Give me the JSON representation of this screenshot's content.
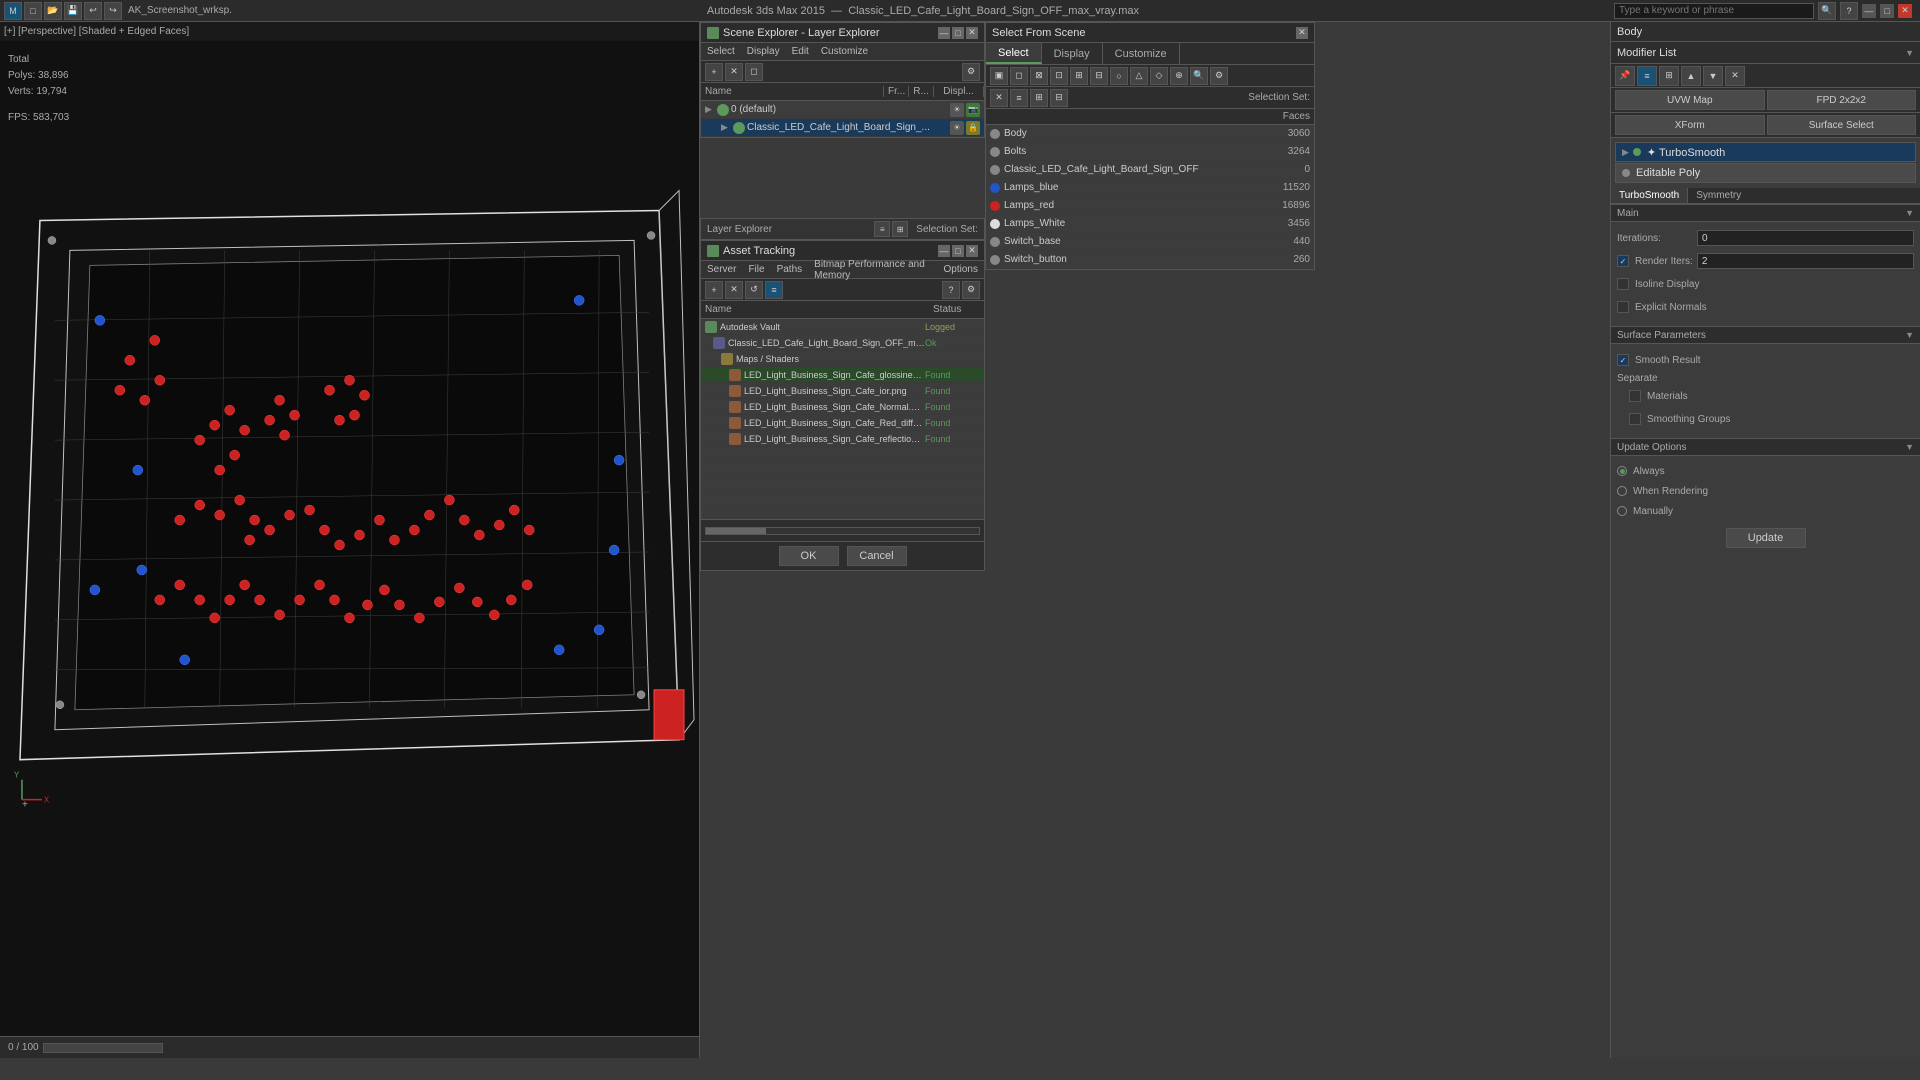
{
  "app": {
    "title": "Autodesk 3ds Max 2015",
    "file": "Classic_LED_Cafe_Light_Board_Sign_OFF_max_vray.max",
    "titlebar_label": "AK_Screenshot_wrksp."
  },
  "search": {
    "placeholder": "Type a keyword or phrase"
  },
  "viewport": {
    "label": "[+] [Perspective] [Shaded + Edged Faces]",
    "stats_label": "Total",
    "polys_label": "Polys:",
    "polys_value": "38,896",
    "verts_label": "Verts:",
    "verts_value": "19,794",
    "fps_label": "FPS:",
    "fps_value": "583,703",
    "progress": "0 / 100"
  },
  "layer_explorer": {
    "title": "Scene Explorer - Layer Explorer",
    "menu_items": [
      "Select",
      "Display",
      "Edit",
      "Customize"
    ],
    "columns": [
      "Name",
      "Fr...",
      "R...",
      "Displ..."
    ],
    "layers": [
      {
        "name": "0 (default)",
        "level": 0,
        "expanded": true
      },
      {
        "name": "Classic_LED_Cafe_Light_Board_Sign_...",
        "level": 1,
        "expanded": true
      }
    ]
  },
  "explorer_bottom": {
    "label": "Layer Explorer",
    "selection_set": "Selection Set:"
  },
  "select_from_scene": {
    "title": "Select From Scene",
    "tabs": [
      "Select",
      "Display",
      "Customize"
    ],
    "active_tab": "Select",
    "toolbar_btn_labels": [
      "all",
      "none",
      "invert",
      "sel_dep"
    ],
    "list_header_label": "Faces",
    "selection_set_label": "Selection Set:",
    "items": [
      {
        "name": "Body",
        "count": "3060"
      },
      {
        "name": "Bolts",
        "count": "3264"
      },
      {
        "name": "Classic_LED_Cafe_Light_Board_Sign_OFF",
        "count": "0"
      },
      {
        "name": "Lamps_blue",
        "count": "11520"
      },
      {
        "name": "Lamps_red",
        "count": "16896"
      },
      {
        "name": "Lamps_White",
        "count": "3456"
      },
      {
        "name": "Switch_base",
        "count": "440"
      },
      {
        "name": "Switch_button",
        "count": "260"
      }
    ]
  },
  "asset_tracking": {
    "title": "Asset Tracking",
    "menu_items": [
      "Server",
      "File",
      "Paths",
      "Bitmap Performance and Memory",
      "Options"
    ],
    "columns": [
      "Name",
      "Status"
    ],
    "items": [
      {
        "name": "Autodesk Vault",
        "level": 0,
        "type": "vault",
        "status": "Logged"
      },
      {
        "name": "Classic_LED_Cafe_Light_Board_Sign_OFF_max_vr...",
        "level": 1,
        "type": "file",
        "status": "Ok"
      },
      {
        "name": "Maps / Shaders",
        "level": 2,
        "type": "folder",
        "status": ""
      },
      {
        "name": "LED_Light_Business_Sign_Cafe_glossiness...",
        "level": 3,
        "type": "texture",
        "status": "Found"
      },
      {
        "name": "LED_Light_Business_Sign_Cafe_ior.png",
        "level": 3,
        "type": "texture",
        "status": "Found"
      },
      {
        "name": "LED_Light_Business_Sign_Cafe_Normal.png",
        "level": 3,
        "type": "texture",
        "status": "Found"
      },
      {
        "name": "LED_Light_Business_Sign_Cafe_Red_diffus...",
        "level": 3,
        "type": "texture",
        "status": "Found"
      },
      {
        "name": "LED_Light_Business_Sign_Cafe_reflection.p...",
        "level": 3,
        "type": "texture",
        "status": "Found"
      }
    ],
    "ok_btn": "OK",
    "cancel_btn": "Cancel"
  },
  "modifier_panel": {
    "title": "Body",
    "modifier_list_label": "Modifier List",
    "stack_items": [
      {
        "name": "TurboSmooth",
        "type": "modifier",
        "arrow": true
      },
      {
        "name": "Editable Poly",
        "type": "base"
      }
    ],
    "buttons": [
      "UVW Map",
      "FPD 2x2x2",
      "XForm",
      "Surface Select"
    ],
    "turbosmo_tabs": [
      "TurboSmooth",
      "Symmetry"
    ],
    "main_section": "Main",
    "iterations_label": "Iterations:",
    "iterations_value": "0",
    "render_iters_label": "Render Iters:",
    "render_iters_value": "2",
    "checkboxes": [
      {
        "label": "Isoline Display",
        "checked": false
      },
      {
        "label": "Explicit Normals",
        "checked": false
      }
    ],
    "surface_params": "Surface Parameters",
    "smooth_result_label": "Smooth Result",
    "smooth_result_checked": true,
    "separate_label": "Separate",
    "materials_label": "Materials",
    "materials_checked": false,
    "smoothing_groups_label": "Smoothing Groups",
    "smoothing_groups_checked": false,
    "update_options": "Update Options",
    "radio_options": [
      "Always",
      "When Rendering",
      "Manually"
    ],
    "selected_radio": "Always",
    "update_btn": "Update"
  }
}
